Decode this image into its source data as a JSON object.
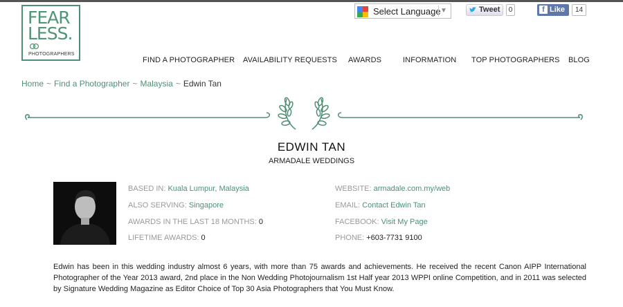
{
  "logo": {
    "line1": "FEAR",
    "line2": "LESS.",
    "sub": "PHOTOGRAPHERS"
  },
  "language": {
    "label": "Select Language"
  },
  "social": {
    "tweet_label": "Tweet",
    "tweet_count": "0",
    "like_label": "Like",
    "like_count": "14"
  },
  "nav": [
    "FIND A PHOTOGRAPHER",
    "AVAILABILITY REQUESTS",
    "AWARDS",
    "INFORMATION",
    "TOP PHOTOGRAPHERS",
    "BLOG"
  ],
  "breadcrumb": {
    "items": [
      "Home",
      "Find a Photographer",
      "Malaysia"
    ],
    "current": "Edwin Tan",
    "separator": "~"
  },
  "profile": {
    "name": "EDWIN TAN",
    "studio": "ARMADALE WEDDINGS",
    "left": [
      {
        "label": "BASED IN:",
        "value": "Kuala Lumpur, Malaysia"
      },
      {
        "label": "ALSO SERVING:",
        "value": "Singapore"
      },
      {
        "label": "AWARDS IN THE LAST 18 MONTHS:",
        "value": "0"
      },
      {
        "label": "LIFETIME AWARDS:",
        "value": "0"
      }
    ],
    "right": [
      {
        "label": "WEBSITE:",
        "value": "armadale.com.my/web"
      },
      {
        "label": "EMAIL:",
        "value": "Contact Edwin Tan"
      },
      {
        "label": "FACEBOOK:",
        "value": "Visit My Page"
      },
      {
        "label": "PHONE:",
        "value": "+603-7731 9100"
      }
    ],
    "bio": "Edwin has been in this wedding industry almost 6 years, with more than 75 awards and achievements. He received the recent Canon AIPP International Photographer of the Year 2013 award, 2nd place in the Non Wedding Photojournalism 1st Half year 2013 WPPI online Competition, and in 2011 was selected by Signature Wedding Magazine as Editor Choice of Top 30 Asia Photographers that You Must Know."
  },
  "colors": {
    "accent": "#4e8f74",
    "text": "#222222",
    "muted": "#999999"
  }
}
